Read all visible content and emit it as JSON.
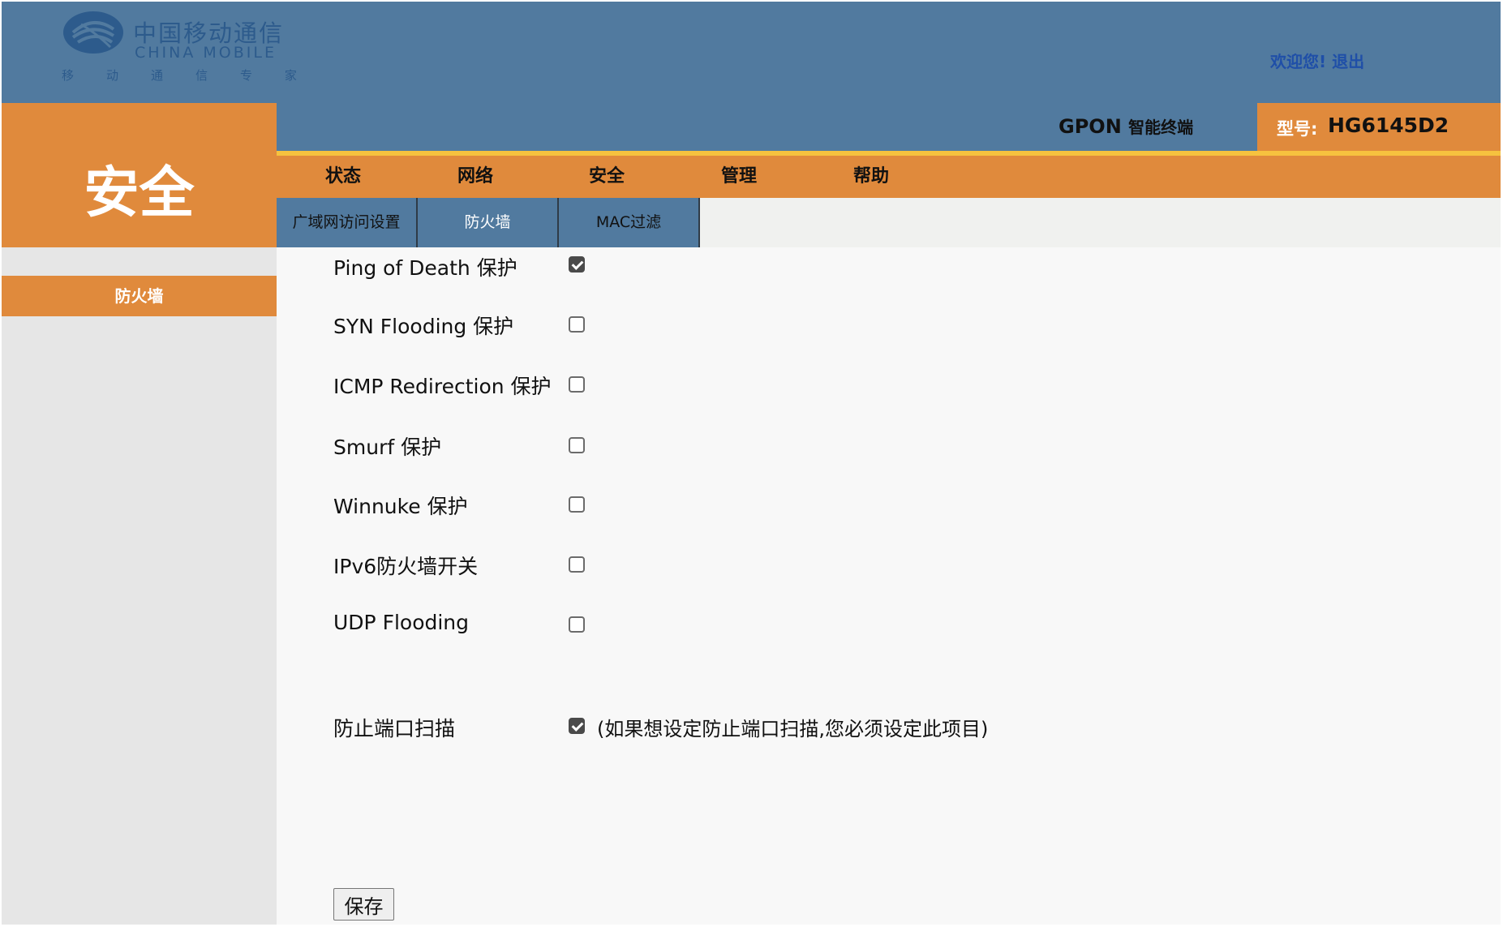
{
  "brand": {
    "name_cn": "中国移动通信",
    "name_en": "CHINA MOBILE",
    "slogan": [
      "移",
      "动",
      "通",
      "信",
      "专",
      "家"
    ]
  },
  "header": {
    "welcome": "欢迎您!",
    "logout": "退出"
  },
  "product": {
    "name": "GPON",
    "subtitle": "智能终端",
    "model_label": "型号:",
    "model": "HG6145D2"
  },
  "section": {
    "title": "安全"
  },
  "nav": [
    "状态",
    "网络",
    "安全",
    "管理",
    "帮助"
  ],
  "sub_tabs": [
    "广域网访问设置",
    "防火墙",
    "MAC过滤"
  ],
  "sidebar": {
    "items": [
      "防火墙"
    ]
  },
  "form": {
    "options": [
      {
        "label": "Ping of Death 保护",
        "checked": true
      },
      {
        "label": "SYN Flooding 保护",
        "checked": false
      },
      {
        "label": "ICMP Redirection 保护",
        "checked": false
      },
      {
        "label": "Smurf 保护",
        "checked": false
      },
      {
        "label": "Winnuke 保护",
        "checked": false
      },
      {
        "label": "IPv6防火墙开关",
        "checked": false
      },
      {
        "label": "UDP Flooding",
        "checked": false
      }
    ],
    "port_scan": {
      "label": "防止端口扫描",
      "checked": true,
      "note": "(如果想设定防止端口扫描,您必须设定此项目)"
    },
    "save_label": "保存"
  },
  "colors": {
    "header_blue": "#517a9f",
    "orange": "#e08a3c",
    "yellow": "#f6c23f",
    "link_blue": "#1f4fa8"
  }
}
